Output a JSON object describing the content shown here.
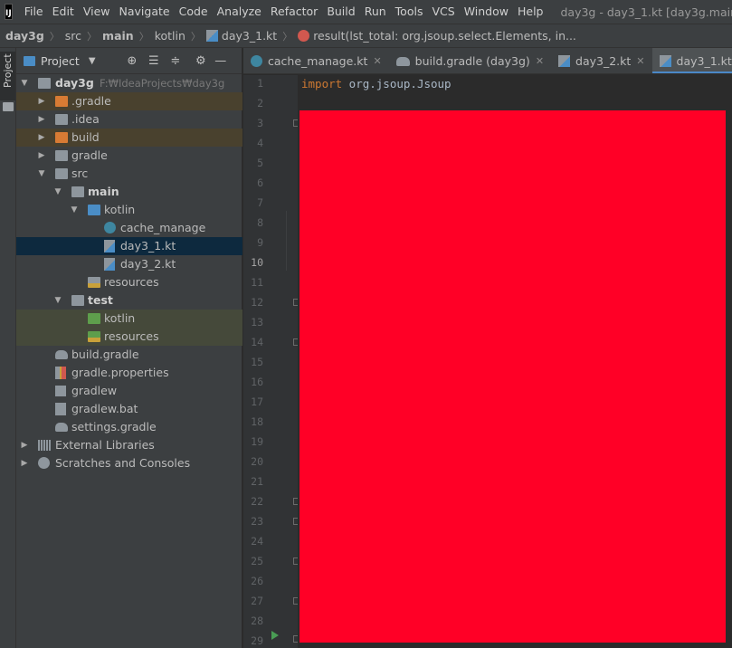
{
  "menubar": {
    "logo_text": "IJ",
    "items": [
      "File",
      "Edit",
      "View",
      "Navigate",
      "Code",
      "Analyze",
      "Refactor",
      "Build",
      "Run",
      "Tools",
      "VCS",
      "Window",
      "Help"
    ],
    "window_title": "day3g - day3_1.kt [day3g.main]"
  },
  "breadcrumb": {
    "items": [
      "day3g",
      "src",
      "main",
      "kotlin",
      "day3_1.kt",
      "result(lst_total: org.jsoup.select.Elements, in..."
    ]
  },
  "left_stripe": {
    "project_label": "Project"
  },
  "project_panel": {
    "title": "Project",
    "tree": [
      {
        "label": "day3g",
        "hint": "F:₩IdeaProjects₩day3g"
      },
      {
        "label": ".gradle"
      },
      {
        "label": ".idea"
      },
      {
        "label": "build"
      },
      {
        "label": "gradle"
      },
      {
        "label": "src"
      },
      {
        "label": "main"
      },
      {
        "label": "kotlin"
      },
      {
        "label": "cache_manage"
      },
      {
        "label": "day3_1.kt"
      },
      {
        "label": "day3_2.kt"
      },
      {
        "label": "resources"
      },
      {
        "label": "test"
      },
      {
        "label": "kotlin"
      },
      {
        "label": "resources"
      },
      {
        "label": "build.gradle"
      },
      {
        "label": "gradle.properties"
      },
      {
        "label": "gradlew"
      },
      {
        "label": "gradlew.bat"
      },
      {
        "label": "settings.gradle"
      },
      {
        "label": "External Libraries"
      },
      {
        "label": "Scratches and Consoles"
      }
    ]
  },
  "tabs": [
    {
      "label": "cache_manage.kt",
      "icon": "kotlin-class-icon"
    },
    {
      "label": "build.gradle (day3g)",
      "icon": "gradle-icon"
    },
    {
      "label": "day3_2.kt",
      "icon": "kotlin-file-icon"
    },
    {
      "label": "day3_1.kt",
      "icon": "kotlin-file-icon",
      "active": true
    }
  ],
  "editor": {
    "line_numbers": [
      "1",
      "2",
      "3",
      "4",
      "5",
      "6",
      "7",
      "8",
      "9",
      "10",
      "11",
      "12",
      "13",
      "14",
      "15",
      "16",
      "17",
      "18",
      "19",
      "20",
      "21",
      "22",
      "23",
      "24",
      "25",
      "26",
      "27",
      "28",
      "29"
    ],
    "current_line": "10",
    "code_keyword": "import",
    "code_rest": " org.jsoup.Jsoup",
    "redaction_color": "#ff0026"
  }
}
